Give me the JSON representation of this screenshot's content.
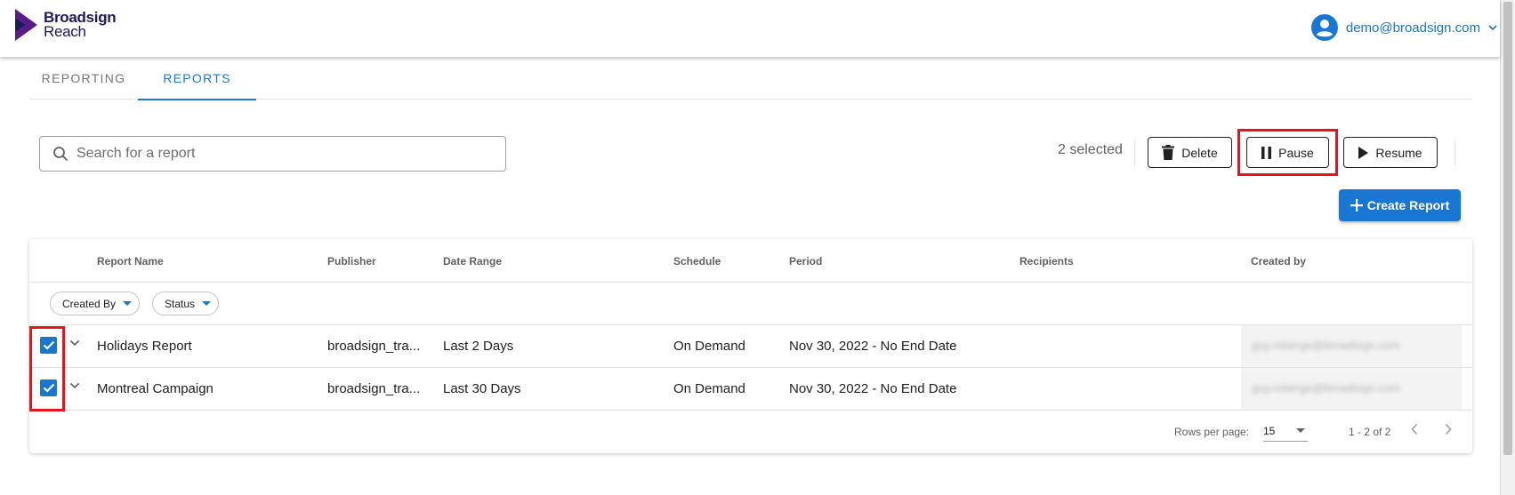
{
  "header": {
    "logo": {
      "line1": "Broadsign",
      "line2": "Reach",
      "brand_color": "#1d1a5c",
      "accent_color": "#5b1a8a"
    },
    "account": {
      "email": "demo@broadsign.com",
      "avatar_icon": "account-circle-icon",
      "menu_icon": "chevron-down-icon"
    }
  },
  "tabs": [
    {
      "label": "REPORTING",
      "active": false
    },
    {
      "label": "REPORTS",
      "active": true
    }
  ],
  "toolbar": {
    "search_placeholder": "Search for a report",
    "selected_count": "2 selected",
    "delete_label": "Delete",
    "pause_label": "Pause",
    "resume_label": "Resume",
    "create_label": "Create Report"
  },
  "table": {
    "columns": [
      "Report Name",
      "Publisher",
      "Date Range",
      "Schedule",
      "Period",
      "Recipients",
      "Created by"
    ],
    "filters": [
      "Created By",
      "Status"
    ],
    "rows": [
      {
        "checked": true,
        "name": "Holidays Report",
        "publisher": "broadsign_tra...",
        "date_range": "Last 2 Days",
        "schedule": "On Demand",
        "period": "Nov 30, 2022 - No End Date",
        "recipients": "",
        "created_by": "guy.roberge@broadsign.com"
      },
      {
        "checked": true,
        "name": "Montreal Campaign",
        "publisher": "broadsign_tra...",
        "date_range": "Last 30 Days",
        "schedule": "On Demand",
        "period": "Nov 30, 2022 - No End Date",
        "recipients": "",
        "created_by": "guy.roberge@broadsign.com"
      }
    ],
    "footer": {
      "rows_per_page_label": "Rows per page:",
      "rows_per_page": "15",
      "range": "1 - 2 of 2"
    }
  },
  "colors": {
    "primary": "#1976d2",
    "highlight": "#e8141c"
  }
}
